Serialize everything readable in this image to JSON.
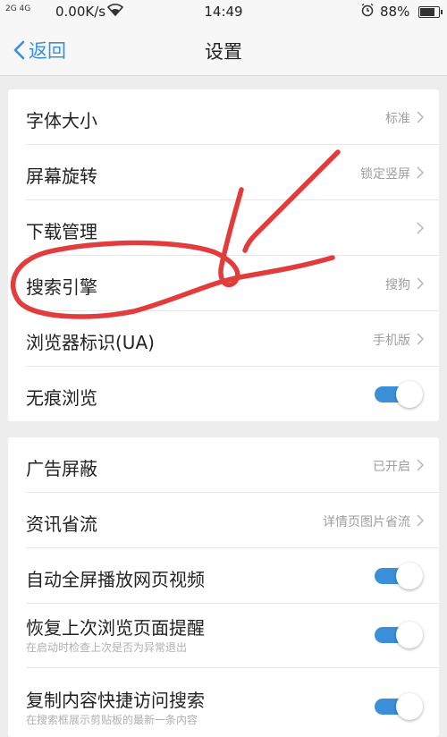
{
  "status_bar": {
    "signal": "2G 4G",
    "speed": "0.00K/s",
    "time": "14:49",
    "battery": "88%",
    "battery_level": 0.88,
    "wifi_icon": "wifi-icon",
    "alarm_icon": "alarm-icon"
  },
  "nav": {
    "back_label": "返回",
    "title": "设置",
    "accent": "#3b8fd8"
  },
  "group1": {
    "rows": [
      {
        "label": "字体大小",
        "value": "标准"
      },
      {
        "label": "屏幕旋转",
        "value": "锁定竖屏"
      },
      {
        "label": "下载管理",
        "value": ""
      },
      {
        "label": "搜索引擎",
        "value": "搜狗"
      },
      {
        "label": "浏览器标识(UA)",
        "value": "手机版"
      },
      {
        "label": "无痕浏览",
        "toggle": true
      }
    ]
  },
  "group2": {
    "rows": [
      {
        "label": "广告屏蔽",
        "value": "已开启"
      },
      {
        "label": "资讯省流",
        "value": "详情页图片省流"
      },
      {
        "label": "自动全屏播放网页视频",
        "toggle": true
      },
      {
        "label": "恢复上次浏览页面提醒",
        "sub": "在启动时检查上次是否为异常退出",
        "toggle": true
      },
      {
        "label": "复制内容快捷访问搜索",
        "sub": "在搜索框展示剪贴板的最新一条内容",
        "toggle": true
      }
    ]
  },
  "colors": {
    "toggle_on": "#3b8fd8",
    "annotation": "#e02b2b"
  }
}
